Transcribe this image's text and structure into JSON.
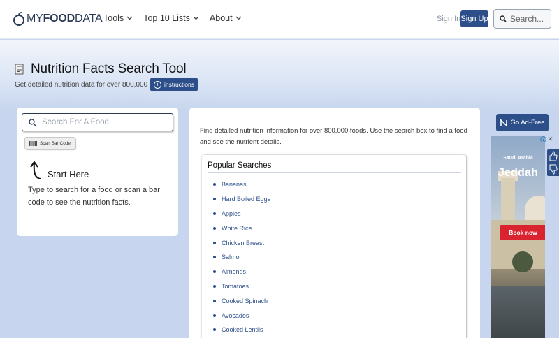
{
  "header": {
    "logo_my": "MY",
    "logo_food": "FOOD",
    "logo_data": "DATA",
    "nav": [
      {
        "label": "Tools"
      },
      {
        "label": "Top 10 Lists"
      },
      {
        "label": "About"
      }
    ],
    "sign_in": "Sign In",
    "sign_up": "Sign Up",
    "search_placeholder": "Search..."
  },
  "page": {
    "title": "Nutrition Facts Search Tool",
    "subtitle": "Get detailed nutrition data for over 800,000 foods.",
    "instructions_label": "instructions"
  },
  "search_card": {
    "placeholder": "Search For A Food",
    "barcode_label": "Scan Bar Code",
    "start_here": "Start Here",
    "description": "Type to search for a food or scan a bar code to see the nutrition facts."
  },
  "main": {
    "description": "Find detailed nutrition information for over 800,000 foods. Use the search box to find a food and see the nutrient details.",
    "popular_title": "Popular Searches",
    "popular": [
      "Bananas",
      "Hard Boiled Eggs",
      "Apples",
      "White Rice",
      "Chicken Breast",
      "Salmon",
      "Almonds",
      "Tomatoes",
      "Cooked Spinach",
      "Avocados",
      "Cooked Lentils"
    ]
  },
  "ad": {
    "go_ad_free": "Go Ad-Free",
    "region": "Saudi Arabia",
    "city": "Jeddah",
    "cta": "Book now"
  },
  "colors": {
    "accent": "#2c4f8a",
    "background": "#c7d6ee",
    "ad_cta": "#d9232e"
  }
}
